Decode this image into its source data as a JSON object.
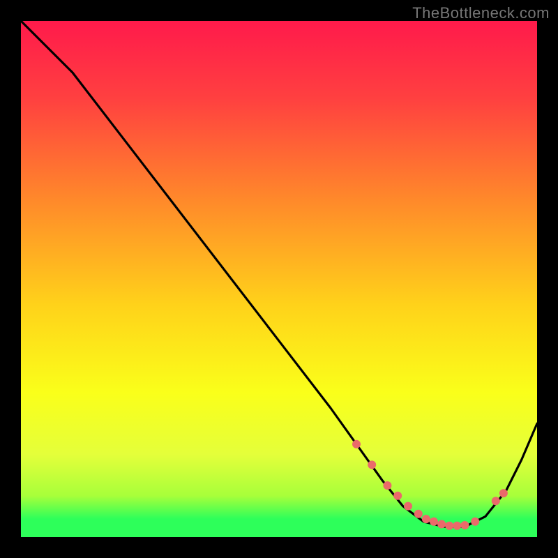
{
  "watermark": "TheBottleneck.com",
  "chart_data": {
    "type": "line",
    "title": "",
    "xlabel": "",
    "ylabel": "",
    "xlim": [
      0,
      100
    ],
    "ylim": [
      0,
      100
    ],
    "grid": false,
    "legend": false,
    "gradient_stops": [
      {
        "offset": 0.0,
        "color": "#ff1a4b"
      },
      {
        "offset": 0.15,
        "color": "#ff4040"
      },
      {
        "offset": 0.35,
        "color": "#ff8a2a"
      },
      {
        "offset": 0.55,
        "color": "#ffd21a"
      },
      {
        "offset": 0.72,
        "color": "#faff1a"
      },
      {
        "offset": 0.84,
        "color": "#e4ff3a"
      },
      {
        "offset": 0.92,
        "color": "#a8ff3a"
      },
      {
        "offset": 0.965,
        "color": "#2dff5a"
      },
      {
        "offset": 1.0,
        "color": "#2dff5a"
      }
    ],
    "series": [
      {
        "name": "bottleneck-curve",
        "color": "#000000",
        "x": [
          0,
          4,
          10,
          20,
          30,
          40,
          50,
          60,
          65,
          70,
          74,
          78,
          82,
          86,
          90,
          94,
          97,
          100
        ],
        "y": [
          100,
          96,
          90,
          77,
          64,
          51,
          38,
          25,
          18,
          11,
          6,
          3,
          2,
          2,
          4,
          9,
          15,
          22
        ]
      }
    ],
    "markers": {
      "name": "highlight-dots",
      "color": "#ea6a6a",
      "radius": 6,
      "x": [
        65,
        68,
        71,
        73,
        75,
        77,
        78.5,
        80,
        81.5,
        83,
        84.5,
        86,
        88,
        92,
        93.5
      ],
      "y": [
        18,
        14,
        10,
        8,
        6,
        4.5,
        3.5,
        3,
        2.5,
        2.2,
        2.2,
        2.3,
        3,
        7,
        8.5
      ]
    }
  }
}
